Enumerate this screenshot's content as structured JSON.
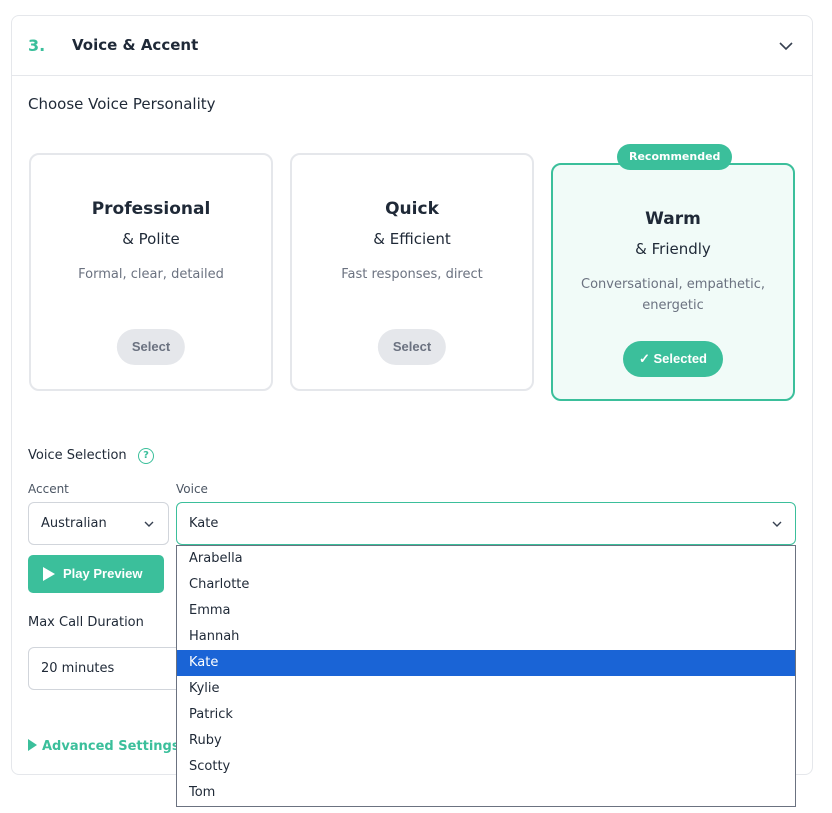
{
  "section": {
    "number": "3.",
    "title": "Voice & Accent"
  },
  "personality": {
    "heading": "Choose Voice Personality",
    "cards": [
      {
        "title": "Professional",
        "subtitle": "& Polite",
        "description": "Formal, clear, detailed",
        "button": "Select"
      },
      {
        "title": "Quick",
        "subtitle": "& Efficient",
        "description": "Fast responses, direct",
        "button": "Select"
      },
      {
        "title": "Warm",
        "subtitle": "& Friendly",
        "description": "Conversational, empathetic, energetic",
        "button": "✓ Selected",
        "badge": "Recommended"
      }
    ]
  },
  "voice_selection": {
    "label": "Voice Selection",
    "help_icon": "?",
    "accent_label": "Accent",
    "accent_value": "Australian",
    "voice_label": "Voice",
    "voice_value": "Kate",
    "options": [
      "Arabella",
      "Charlotte",
      "Emma",
      "Hannah",
      "Kate",
      "Kylie",
      "Patrick",
      "Ruby",
      "Scotty",
      "Tom"
    ],
    "selected_index": 4
  },
  "preview": {
    "label": "Play Preview"
  },
  "duration": {
    "label": "Max Call Duration",
    "value": "20 minutes"
  },
  "advanced": {
    "label": "Advanced Settings"
  },
  "colors": {
    "accent": "#3bbf9b",
    "selection": "#1a64d6"
  }
}
